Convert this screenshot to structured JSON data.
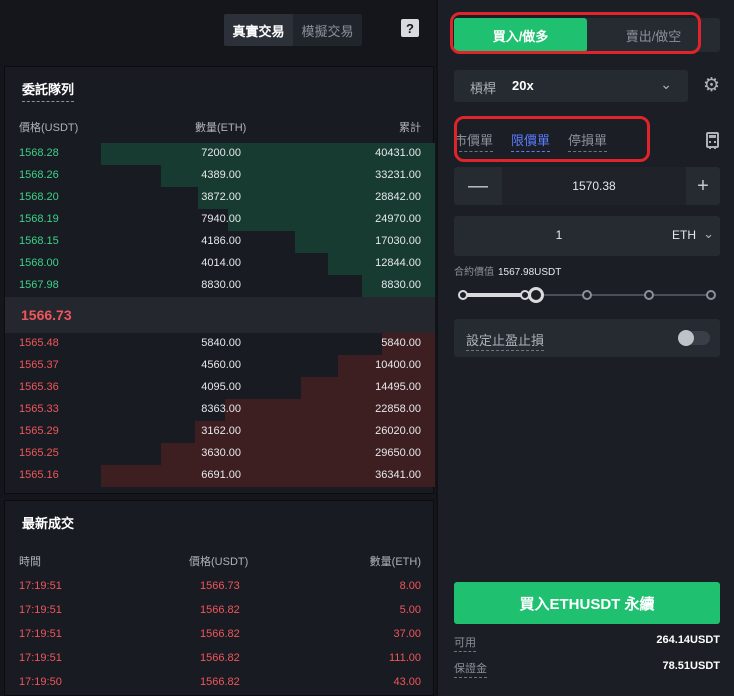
{
  "header": {
    "mode_real": "真實交易",
    "mode_sim": "模擬交易",
    "help_label": "?"
  },
  "orderbook": {
    "title": "委託隊列",
    "col_price": "價格(USDT)",
    "col_qty": "數量(ETH)",
    "col_cum": "累計",
    "bids": [
      {
        "price": "1568.28",
        "qty": "7200.00",
        "cum": "40431.00",
        "depth": 1.0
      },
      {
        "price": "1568.26",
        "qty": "4389.00",
        "cum": "33231.00",
        "depth": 0.82
      },
      {
        "price": "1568.20",
        "qty": "3872.00",
        "cum": "28842.00",
        "depth": 0.71
      },
      {
        "price": "1568.19",
        "qty": "7940.00",
        "cum": "24970.00",
        "depth": 0.62
      },
      {
        "price": "1568.15",
        "qty": "4186.00",
        "cum": "17030.00",
        "depth": 0.42
      },
      {
        "price": "1568.00",
        "qty": "4014.00",
        "cum": "12844.00",
        "depth": 0.32
      },
      {
        "price": "1567.98",
        "qty": "8830.00",
        "cum": "8830.00",
        "depth": 0.22
      }
    ],
    "mid_price": "1566.73",
    "asks": [
      {
        "price": "1565.48",
        "qty": "5840.00",
        "cum": "5840.00",
        "depth": 0.16
      },
      {
        "price": "1565.37",
        "qty": "4560.00",
        "cum": "10400.00",
        "depth": 0.29
      },
      {
        "price": "1565.36",
        "qty": "4095.00",
        "cum": "14495.00",
        "depth": 0.4
      },
      {
        "price": "1565.33",
        "qty": "8363.00",
        "cum": "22858.00",
        "depth": 0.63
      },
      {
        "price": "1565.29",
        "qty": "3162.00",
        "cum": "26020.00",
        "depth": 0.72
      },
      {
        "price": "1565.25",
        "qty": "3630.00",
        "cum": "29650.00",
        "depth": 0.82
      },
      {
        "price": "1565.16",
        "qty": "6691.00",
        "cum": "36341.00",
        "depth": 1.0
      }
    ]
  },
  "trades": {
    "title": "最新成交",
    "col_time": "時間",
    "col_price": "價格(USDT)",
    "col_qty": "數量(ETH)",
    "rows": [
      {
        "time": "17:19:51",
        "price": "1566.73",
        "qty": "8.00"
      },
      {
        "time": "17:19:51",
        "price": "1566.82",
        "qty": "5.00"
      },
      {
        "time": "17:19:51",
        "price": "1566.82",
        "qty": "37.00"
      },
      {
        "time": "17:19:51",
        "price": "1566.82",
        "qty": "111.00"
      },
      {
        "time": "17:19:50",
        "price": "1566.82",
        "qty": "43.00"
      }
    ]
  },
  "order_panel": {
    "buy_tab": "買入/做多",
    "sell_tab": "賣出/做空",
    "leverage_label": "槓桿",
    "leverage_value": "20x",
    "order_types": [
      "市價單",
      "限價單",
      "停損單"
    ],
    "active_order_type": "限價單",
    "price_value": "1570.38",
    "qty_value": "1",
    "qty_unit": "ETH",
    "contract_value_label": "合約價值",
    "contract_value": "1567.98USDT",
    "slider_value": 0.25,
    "tpsl_label": "設定止盈止損",
    "tpsl_enabled": false,
    "submit_label": "買入ETHUSDT 永續",
    "available_label": "可用",
    "available_value": "264.14USDT",
    "margin_label": "保證金",
    "margin_value": "78.51USDT"
  },
  "colors": {
    "buy": "#1fc171",
    "bid_text": "#3dd18a",
    "ask_text": "#f0565b",
    "active_link": "#5b7cff",
    "highlight": "#e0242b"
  }
}
